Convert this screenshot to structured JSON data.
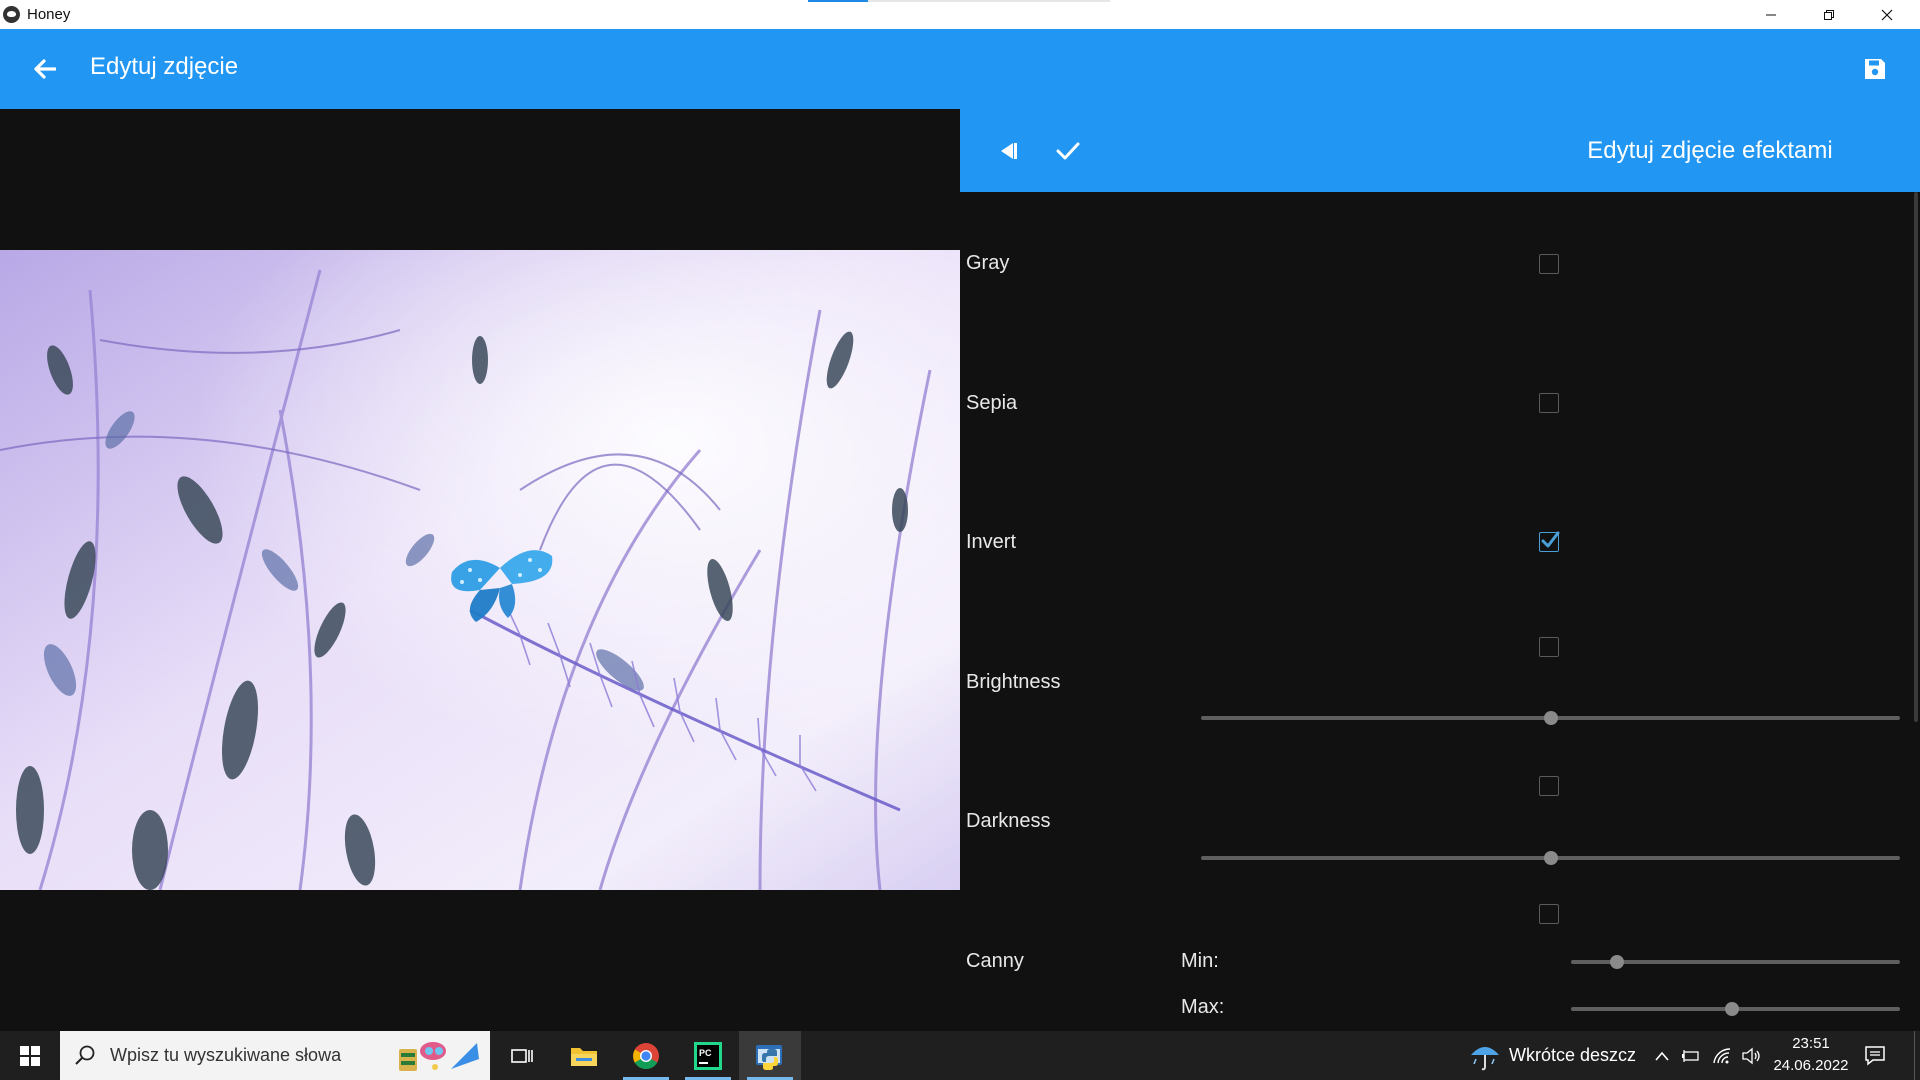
{
  "window": {
    "title": "Honey"
  },
  "appbar": {
    "title": "Edytuj zdjęcie",
    "back_icon": "arrow-left-icon",
    "save_icon": "floppy-disk-icon"
  },
  "panel": {
    "title": "Edytuj zdjęcie efektami",
    "collapse_icon": "collapse-panel-icon",
    "confirm_icon": "check-icon",
    "effects": [
      {
        "label": "Gray",
        "checked": false
      },
      {
        "label": "Sepia",
        "checked": false
      },
      {
        "label": "Invert",
        "checked": true
      },
      {
        "label": "Brightness",
        "checked": false,
        "slider_value": 0.5
      },
      {
        "label": "Darkness",
        "checked": false,
        "slider_value": 0.5
      },
      {
        "label": "Canny",
        "checked": false,
        "min_label": "Min:",
        "min_value": 0.14,
        "max_label": "Max:",
        "max_value": 0.49
      }
    ]
  },
  "taskbar": {
    "search_placeholder": "Wpisz tu wyszukiwane słowa",
    "weather_text": "Wkrótce deszcz",
    "time": "23:51",
    "date": "24.06.2022",
    "pinned": [
      "task-view-icon",
      "file-explorer-icon",
      "chrome-icon",
      "pycharm-icon",
      "python-app-icon"
    ]
  },
  "colors": {
    "accent": "#2196f3",
    "background": "#111111",
    "checkbox_checked": "#4a9fd8"
  }
}
